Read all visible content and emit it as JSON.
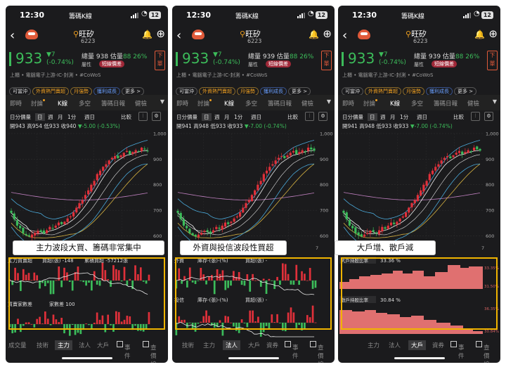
{
  "status": {
    "time": "12:30",
    "battery": "12",
    "carrier": "籌碼K線",
    "wifi": "WiFi"
  },
  "stock": {
    "name": "旺矽",
    "code": "6223",
    "price": "933",
    "change": "▼7",
    "change_pct": "(-0.74%)",
    "attr_label": "屬性",
    "attr_tag": "短線價差",
    "order_label": "下單",
    "categories": "上櫃 • 電腦電子上游-IC-封測 • #CoWoS"
  },
  "screens": [
    {
      "volume": "總量 938",
      "estimate_label": "估量",
      "estimate_value": "88 26%",
      "ohlc_text": "開943 高954 低933 收940",
      "ohlc_change": "▼-5.00 (-0.53%)"
    },
    {
      "volume": "總量 939",
      "estimate_label": "估量",
      "estimate_value": "88 26%",
      "ohlc_text": "開941 高948 低933 收933",
      "ohlc_change": "▼-7.00 (-0.74%)"
    },
    {
      "volume": "總量 939",
      "estimate_label": "估量",
      "estimate_value": "88 26%",
      "ohlc_text": "開941 高948 低933 收933",
      "ohlc_change": "▼-7.00 (-0.74%)"
    }
  ],
  "pills": [
    "可當沖",
    "外資熱門賣超",
    "月強勢",
    "獲利成長",
    "更多 >"
  ],
  "tabs": [
    "即時",
    "討論",
    "K線",
    "多空",
    "籌碼日報",
    "健檢"
  ],
  "timeframes": [
    "日分價量",
    "日",
    "週",
    "月",
    "1分",
    "週日"
  ],
  "tf_right": [
    "比較"
  ],
  "y_ticks": [
    "1,000",
    "900",
    "800",
    "700",
    "600"
  ],
  "x_tick": "7",
  "captions": [
    "主力波段大買、籌碼非常集中",
    "外資與投信波段性買超",
    "大戶增、散戶減"
  ],
  "panels": {
    "s1": {
      "top_label": "主力買賣超",
      "top_unit": "買超(張) -148",
      "top_extra": "累積買超 -57212張",
      "bottom_label": "買賣家數差",
      "bottom_unit": "家數差 100"
    },
    "s2": {
      "top_label": "外資",
      "top_unit": "庫存-(張)-(%)",
      "top_extra": "買超(張) -",
      "bottom_label": "投信",
      "bottom_unit": "庫存-(張)-(%)",
      "bottom_extra": "買超(張) -"
    },
    "s3": {
      "top_label": "大戶持股比率",
      "top_value": "33.36 %",
      "top_right1": "33.35%",
      "top_right2": "31.50%",
      "bottom_label": "散戶持股比率",
      "bottom_value": "30.84 %",
      "bottom_right1": "36.35%",
      "bottom_right2": "30.84%"
    }
  },
  "bottom_tabs": [
    [
      "成交量",
      "技術",
      "主力",
      "法人",
      "大戶"
    ],
    [
      "技術",
      "主力",
      "法人",
      "大戶",
      "資券"
    ],
    [
      "主力",
      "法人",
      "大戶",
      "資券"
    ]
  ],
  "bottom_active": [
    "主力",
    "法人",
    "大戶"
  ],
  "checks": [
    "事件",
    "查價線"
  ],
  "colors": {
    "up": "#e0303a",
    "down": "#3cbc5a",
    "accent": "#f0a020",
    "frame": "#f0b400"
  },
  "chart_data": {
    "type": "candlestick",
    "y_range": [
      560,
      1000
    ],
    "close": [
      690,
      665,
      640,
      630,
      610,
      602,
      598,
      605,
      612,
      620,
      616,
      610,
      622,
      635,
      628,
      640,
      652,
      646,
      655,
      668,
      676,
      692,
      710,
      728,
      740,
      760,
      778,
      800,
      815,
      842,
      855,
      870,
      880,
      895,
      905,
      912,
      904,
      915,
      925,
      932,
      920,
      928,
      935,
      930,
      945,
      938,
      933
    ]
  }
}
